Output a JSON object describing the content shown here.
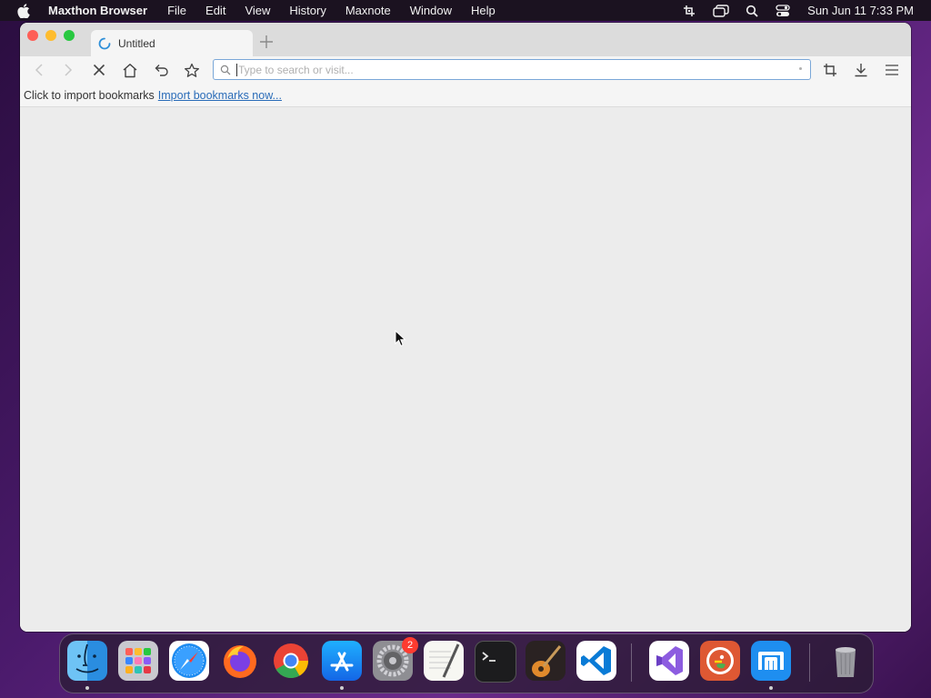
{
  "menubar": {
    "app_name": "Maxthon Browser",
    "items": [
      "File",
      "Edit",
      "View",
      "History",
      "Maxnote",
      "Window",
      "Help"
    ],
    "clock": "Sun Jun 11  7:33 PM"
  },
  "window": {
    "tab_title": "Untitled",
    "address": {
      "value": "",
      "placeholder": "Type to search or visit..."
    },
    "bookmarks_bar": {
      "text": "Click to import bookmarks",
      "link": "Import bookmarks now..."
    }
  },
  "dock": {
    "items": [
      {
        "name": "Finder",
        "icon": "finder-icon",
        "running": true
      },
      {
        "name": "Launchpad",
        "icon": "launchpad-icon",
        "running": false
      },
      {
        "name": "Safari",
        "icon": "safari-icon",
        "running": false
      },
      {
        "name": "Firefox",
        "icon": "firefox-icon",
        "running": false
      },
      {
        "name": "Google Chrome",
        "icon": "chrome-icon",
        "running": false
      },
      {
        "name": "App Store",
        "icon": "app-store-icon",
        "running": true
      },
      {
        "name": "System Preferences",
        "icon": "system-preferences-icon",
        "running": false,
        "badge": "2"
      },
      {
        "name": "TextEdit",
        "icon": "textedit-icon",
        "running": false
      },
      {
        "name": "Terminal",
        "icon": "terminal-icon",
        "running": false
      },
      {
        "name": "GarageBand",
        "icon": "garageband-icon",
        "running": false
      },
      {
        "name": "Visual Studio Code",
        "icon": "vscode-icon",
        "running": false
      },
      {
        "name": "Visual Studio",
        "icon": "visual-studio-icon",
        "running": false
      },
      {
        "name": "DuckDuckGo",
        "icon": "duckduckgo-icon",
        "running": false
      },
      {
        "name": "Maxthon",
        "icon": "maxthon-icon",
        "running": true
      },
      {
        "name": "Trash",
        "icon": "trash-icon",
        "running": false
      }
    ]
  },
  "colors": {
    "accent": "#2a6cb8",
    "address_border": "#7aa7d8",
    "badge": "#ff3b30"
  }
}
